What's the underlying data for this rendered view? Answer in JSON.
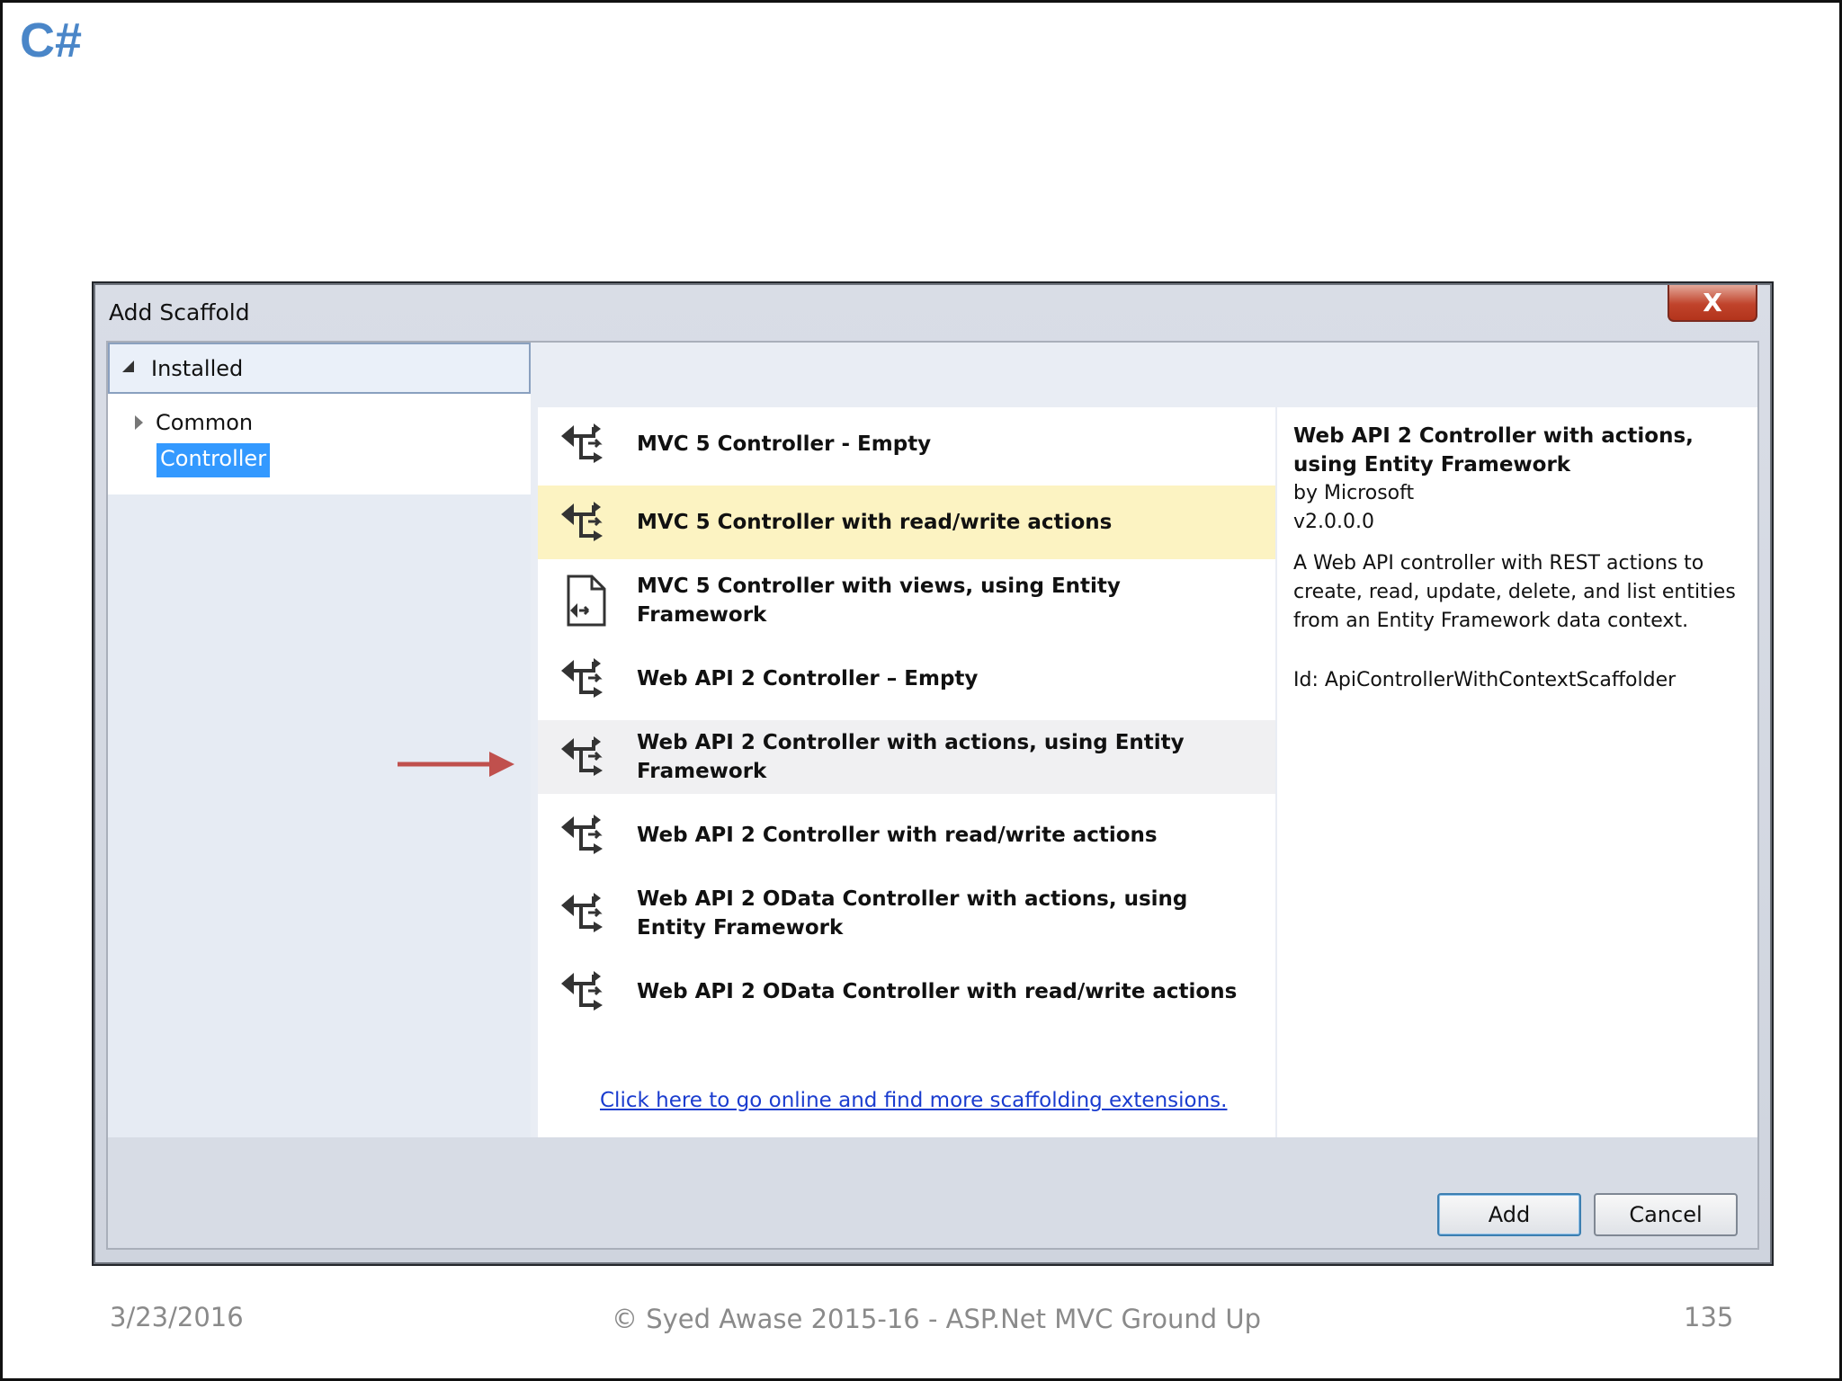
{
  "brand": "C#",
  "dialog": {
    "title": "Add Scaffold",
    "close_label": "X",
    "tree": {
      "header": "Installed",
      "items": [
        {
          "label": "Common"
        },
        {
          "label": "Controller",
          "selected": true
        }
      ]
    },
    "templates": [
      {
        "label": "MVC 5 Controller - Empty",
        "icon": "controller-icon",
        "state": "normal"
      },
      {
        "label": "MVC 5 Controller with read/write actions",
        "icon": "controller-icon",
        "state": "selected"
      },
      {
        "label": "MVC 5 Controller with views, using Entity Framework",
        "icon": "views-controller-icon",
        "state": "normal"
      },
      {
        "label": "Web API 2 Controller – Empty",
        "icon": "controller-icon",
        "state": "normal"
      },
      {
        "label": "Web API 2 Controller with actions, using Entity Framework",
        "icon": "controller-icon",
        "state": "hover"
      },
      {
        "label": "Web API 2 Controller with read/write actions",
        "icon": "controller-icon",
        "state": "normal"
      },
      {
        "label": "Web API 2 OData Controller with actions, using Entity Framework",
        "icon": "controller-icon",
        "state": "normal"
      },
      {
        "label": "Web API 2 OData Controller with read/write actions",
        "icon": "controller-icon",
        "state": "normal"
      }
    ],
    "online_link": "Click here to go online and find more scaffolding extensions.",
    "detail": {
      "title": "Web API 2 Controller with actions, using Entity Framework",
      "author": "by Microsoft",
      "version": "v2.0.0.0",
      "description": "A Web API controller with REST actions to create, read, update, delete, and list entities from an Entity Framework data context.",
      "id": "Id: ApiControllerWithContextScaffolder"
    },
    "buttons": {
      "add": "Add",
      "cancel": "Cancel"
    }
  },
  "colors": {
    "brand": "#4a86c8",
    "selected_row": "#fcf3c2",
    "tree_selection": "#3399ff",
    "arrow": "#c0504d"
  },
  "footer": {
    "date": "3/23/2016",
    "center": "© Syed Awase 2015-16 - ASP.Net MVC Ground Up",
    "page": "135"
  }
}
